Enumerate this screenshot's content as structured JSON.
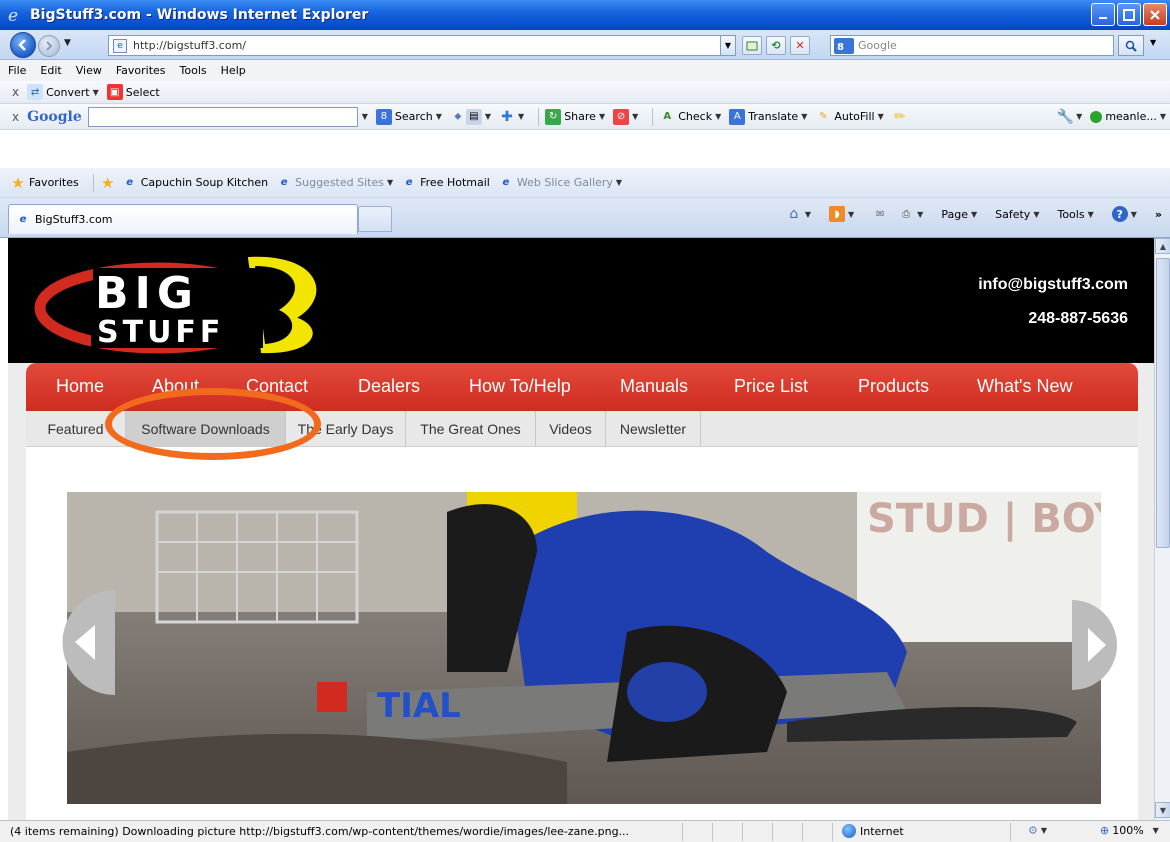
{
  "window": {
    "title": "BigStuff3.com - Windows Internet Explorer"
  },
  "address_bar": {
    "url": "http://bigstuff3.com/",
    "search_placeholder": "Google"
  },
  "menu": {
    "items": [
      "File",
      "Edit",
      "View",
      "Favorites",
      "Tools",
      "Help"
    ]
  },
  "convert_toolbar": {
    "convert_label": "Convert",
    "select_label": "Select"
  },
  "google_toolbar": {
    "brand": "Google",
    "search_label": "Search",
    "share_label": "Share",
    "check_label": "Check",
    "translate_label": "Translate",
    "autofill_label": "AutoFill",
    "user_label": "meanle..."
  },
  "favorites_bar": {
    "favorites_label": "Favorites",
    "links": [
      "Capuchin Soup Kitchen",
      "Suggested Sites",
      "Free Hotmail",
      "Web Slice Gallery"
    ]
  },
  "tabs": {
    "active_title": "BigStuff3.com"
  },
  "command_bar": {
    "page_label": "Page",
    "safety_label": "Safety",
    "tools_label": "Tools"
  },
  "site": {
    "email": "info@bigstuff3.com",
    "phone": "248-887-5636",
    "nav": [
      "Home",
      "About",
      "Contact",
      "Dealers",
      "How To/Help",
      "Manuals",
      "Price List",
      "Products",
      "What's New"
    ],
    "subnav": [
      "Featured",
      "Software Downloads",
      "The Early Days",
      "The Great Ones",
      "Videos",
      "Newsletter"
    ],
    "highlighted_subnav": "Software Downloads"
  },
  "status_bar": {
    "message": "(4 items remaining) Downloading picture http://bigstuff3.com/wp-content/themes/wordie/images/lee-zane.png...",
    "zone": "Internet",
    "zoom": "100%"
  },
  "colors": {
    "nav_red": "#d8362a",
    "highlight_orange": "#f26b1d",
    "header_black": "#000000"
  }
}
